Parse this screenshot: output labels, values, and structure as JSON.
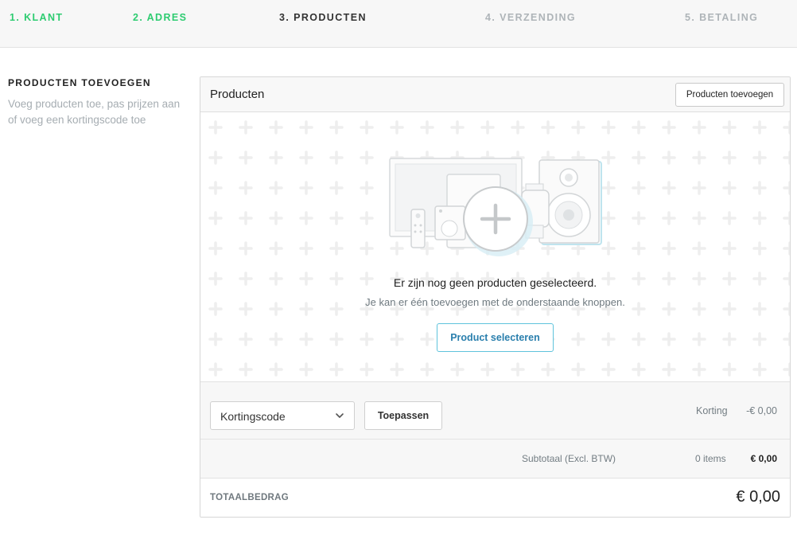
{
  "steps": [
    {
      "label": "1. KLANT",
      "state": "done"
    },
    {
      "label": "2. ADRES",
      "state": "done"
    },
    {
      "label": "3. PRODUCTEN",
      "state": "active"
    },
    {
      "label": "4. VERZENDING",
      "state": "todo"
    },
    {
      "label": "5. BETALING",
      "state": "todo"
    }
  ],
  "intro": {
    "title": "PRODUCTEN TOEVOEGEN",
    "description": "Voeg producten toe, pas prijzen aan of voeg een kortingscode toe"
  },
  "panel": {
    "title": "Producten",
    "add_button": "Producten toevoegen",
    "empty_title": "Er zijn nog geen producten geselecteerd.",
    "empty_subtitle": "Je kan er één toevoegen met de onderstaande knoppen.",
    "select_button": "Product selecteren"
  },
  "discount": {
    "select_value": "Kortingscode",
    "apply_button": "Toepassen",
    "label": "Korting",
    "value": "-€ 0,00"
  },
  "subtotal": {
    "label": "Subtotaal (Excl. BTW)",
    "items": "0 items",
    "value": "€ 0,00"
  },
  "total": {
    "label": "TOTAALBEDRAG",
    "value": "€ 0,00"
  },
  "colors": {
    "done": "#2ecc71",
    "active": "#333333",
    "todo": "#aeb4b8",
    "accent_border": "#5fc3dc",
    "accent_text": "#2a7fad"
  }
}
